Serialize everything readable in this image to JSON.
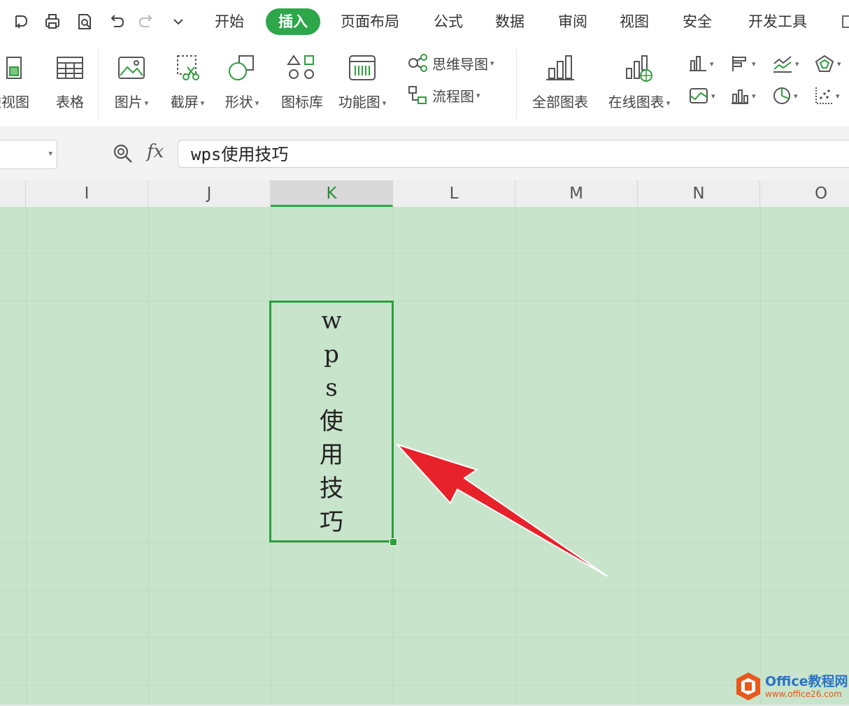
{
  "menu": {
    "tabs": [
      {
        "label": "开始",
        "active": false
      },
      {
        "label": "插入",
        "active": true
      },
      {
        "label": "页面布局",
        "active": false
      },
      {
        "label": "公式",
        "active": false
      },
      {
        "label": "数据",
        "active": false
      },
      {
        "label": "审阅",
        "active": false
      },
      {
        "label": "视图",
        "active": false
      },
      {
        "label": "安全",
        "active": false
      },
      {
        "label": "开发工具",
        "active": false
      }
    ],
    "active_color": "#2ea64a"
  },
  "ribbon": {
    "pivot": "透视图",
    "table": "表格",
    "picture": "图片",
    "screenshot": "截屏",
    "shape": "形状",
    "icon_library": "图标库",
    "function_chart": "功能图",
    "mindmap": "思维导图",
    "flowchart": "流程图",
    "all_charts": "全部图表",
    "online_charts": "在线图表"
  },
  "formula_bar": {
    "fx_label": "fx",
    "value": "wps使用技巧"
  },
  "columns": [
    {
      "label": "I",
      "selected": false
    },
    {
      "label": "J",
      "selected": false
    },
    {
      "label": "K",
      "selected": true
    },
    {
      "label": "L",
      "selected": false
    },
    {
      "label": "M",
      "selected": false
    },
    {
      "label": "N",
      "selected": false
    },
    {
      "label": "O",
      "selected": false
    }
  ],
  "cell": {
    "chars": [
      "w",
      "p",
      "s",
      "使",
      "用",
      "技",
      "巧"
    ]
  },
  "colors": {
    "grid_background": "#c8e4cb",
    "selection_border": "#2e9e3e",
    "arrow": "#e8222a"
  },
  "watermark": {
    "title": "Office教程网",
    "url": "www.office26.com"
  }
}
